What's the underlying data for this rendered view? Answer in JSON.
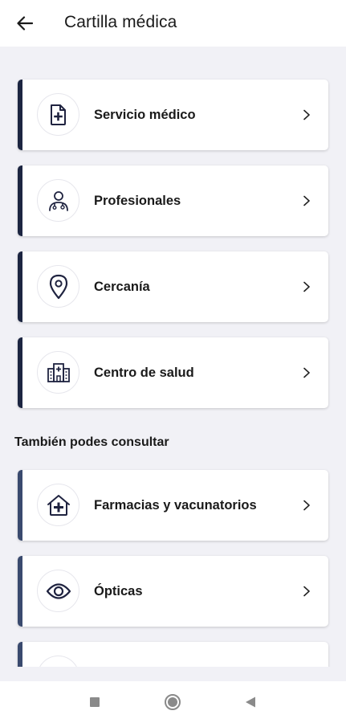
{
  "header": {
    "title": "Cartilla médica",
    "back_icon": "arrow-left-icon"
  },
  "main_items": [
    {
      "label": "Servicio médico",
      "icon": "medical-document-icon"
    },
    {
      "label": "Profesionales",
      "icon": "doctor-icon"
    },
    {
      "label": "Cercanía",
      "icon": "location-pin-icon"
    },
    {
      "label": "Centro de salud",
      "icon": "hospital-building-icon"
    }
  ],
  "section": {
    "title": "También podes consultar"
  },
  "extra_items": [
    {
      "label": "Farmacias y vacunatorios",
      "icon": "pharmacy-house-icon"
    },
    {
      "label": "Ópticas",
      "icon": "eye-icon"
    },
    {
      "label": "",
      "icon": "partial-icon"
    }
  ],
  "nav": {
    "recents_icon": "square-icon",
    "home_icon": "circle-icon",
    "back_icon": "triangle-back-icon"
  },
  "colors": {
    "accent_primary": "#1c2541",
    "accent_secondary": "#3a4a6e",
    "icon_stroke": "#1f2340",
    "background": "#f1f1f6"
  }
}
